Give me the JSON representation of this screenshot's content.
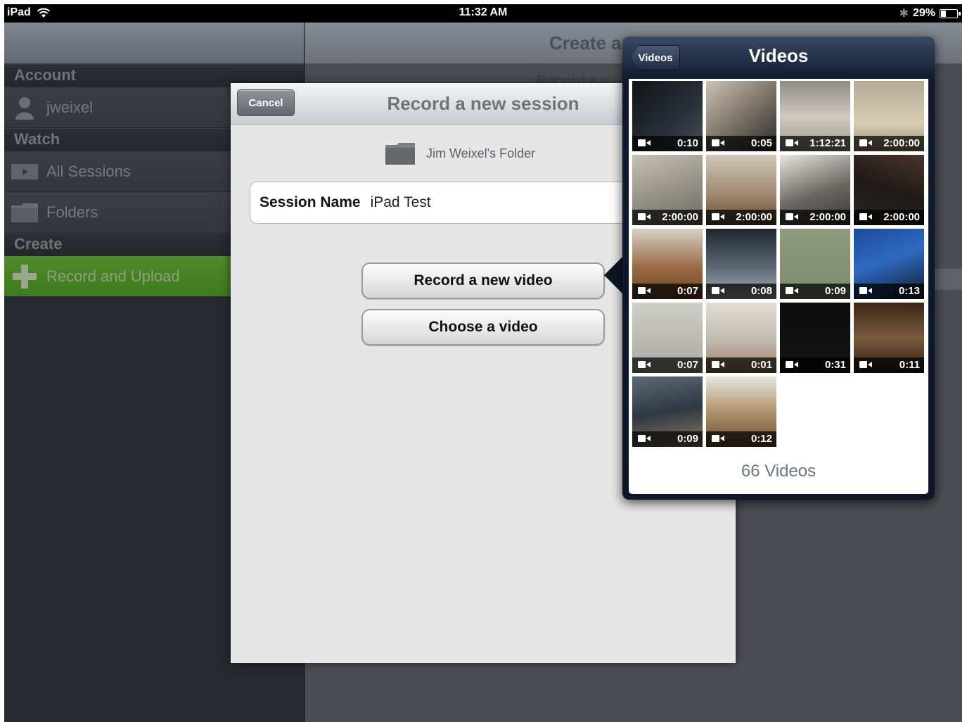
{
  "status": {
    "device": "iPad",
    "time": "11:32 AM",
    "battery": "29%"
  },
  "master": {
    "sections": [
      {
        "title": "Account",
        "rows": [
          {
            "label": "jweixel",
            "icon": "user-icon"
          }
        ]
      },
      {
        "title": "Watch",
        "rows": [
          {
            "label": "All Sessions",
            "icon": "video-icon"
          },
          {
            "label": "Folders",
            "icon": "folder-icon"
          }
        ]
      },
      {
        "title": "Create",
        "rows": [
          {
            "label": "Record and Upload",
            "icon": "plus-icon",
            "selected": true
          }
        ]
      }
    ]
  },
  "detail": {
    "title": "Create a",
    "subtitle": "Record a n"
  },
  "sheet": {
    "cancel": "Cancel",
    "title": "Record a new session",
    "folder": "Jim Weixel's Folder",
    "session_name_label": "Session Name",
    "session_name_value": "iPad Test",
    "record_button": "Record a new video",
    "choose_button": "Choose a video"
  },
  "popover": {
    "back": "Videos",
    "title": "Videos",
    "footer": "66 Videos",
    "videos": [
      {
        "duration": "0:10",
        "bg": "linear-gradient(135deg,#101418,#2a3038 60%,#4a5058)"
      },
      {
        "duration": "0:05",
        "bg": "linear-gradient(140deg,#c9c2b6,#7c7468 50%,#2c2a28)"
      },
      {
        "duration": "1:12:21",
        "bg": "linear-gradient(180deg,#8e8a84,#cfc9c0 50%,#a39c90)"
      },
      {
        "duration": "2:00:00",
        "bg": "linear-gradient(180deg,#b5a895,#d9ccb6 60%,#9c8b74)"
      },
      {
        "duration": "2:00:00",
        "bg": "linear-gradient(160deg,#c5c1b5,#8f8a7f 60%,#6f6a60)"
      },
      {
        "duration": "2:00:00",
        "bg": "linear-gradient(180deg,#cfc7bb,#a08a74 55%,#6b4a32)"
      },
      {
        "duration": "2:00:00",
        "bg": "linear-gradient(160deg,#e8e6e0,#6a6661 55%,#3a3835)"
      },
      {
        "duration": "2:00:00",
        "bg": "linear-gradient(200deg,#4a342a,#1f1a17 50%,#2c2521)"
      },
      {
        "duration": "0:07",
        "bg": "linear-gradient(180deg,#d6d0c6,#9a6a44 55%,#6b4226)"
      },
      {
        "duration": "0:08",
        "bg": "linear-gradient(180deg,#1f262e,#5d6874 55%,#a9b3bb)"
      },
      {
        "duration": "0:09",
        "bg": "linear-gradient(180deg,#8d9a7e,#7d8a6e)"
      },
      {
        "duration": "0:13",
        "bg": "linear-gradient(160deg,#1d4a9a,#2e6ac2 45%,#111a2a)"
      },
      {
        "duration": "0:07",
        "bg": "linear-gradient(180deg,#cfcfc9,#a7a7a0)"
      },
      {
        "duration": "0:01",
        "bg": "linear-gradient(180deg,#e2ded6,#bfb9ae 55%,#a07a5c)"
      },
      {
        "duration": "0:31",
        "bg": "linear-gradient(180deg,#0c0c0c,#141414)"
      },
      {
        "duration": "0:11",
        "bg": "linear-gradient(180deg,#3a2618,#7b5a3e 50%,#2b1c12)"
      },
      {
        "duration": "0:09",
        "bg": "linear-gradient(170deg,#5b6a78,#2f3842 50%,#8d7a63)"
      },
      {
        "duration": "0:12",
        "bg": "linear-gradient(180deg,#e8e6e0,#b49a76 45%,#6a4a2c)"
      }
    ]
  }
}
